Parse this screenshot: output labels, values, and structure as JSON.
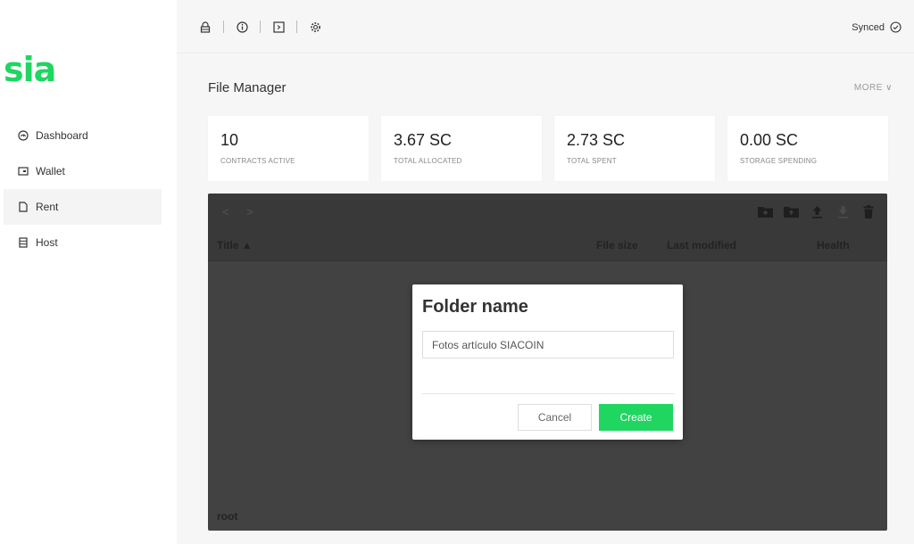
{
  "app": {
    "logo_text": "sia",
    "accent_color": "#1ed660"
  },
  "sidebar": {
    "items": [
      {
        "label": "Dashboard",
        "icon": "gauge-icon",
        "active": false
      },
      {
        "label": "Wallet",
        "icon": "wallet-icon",
        "active": false
      },
      {
        "label": "Rent",
        "icon": "file-icon",
        "active": true
      },
      {
        "label": "Host",
        "icon": "server-icon",
        "active": false
      }
    ]
  },
  "topbar": {
    "icons": [
      "lock-icon",
      "info-icon",
      "terminal-icon",
      "gear-icon"
    ],
    "status": "Synced",
    "status_icon": "check-circle-icon"
  },
  "page": {
    "title": "File Manager",
    "more_label": "MORE ∨"
  },
  "cards": [
    {
      "value": "10",
      "label": "CONTRACTS ACTIVE"
    },
    {
      "value": "3.67 SC",
      "label": "TOTAL ALLOCATED"
    },
    {
      "value": "2.73 SC",
      "label": "TOTAL SPENT"
    },
    {
      "value": "0.00 SC",
      "label": "STORAGE SPENDING"
    }
  ],
  "files": {
    "nav_arrows": "< >",
    "toolbar_icons": [
      "new-folder-icon",
      "upload-folder-icon",
      "upload-icon",
      "download-icon",
      "trash-icon"
    ],
    "columns": {
      "title": "Title ▲",
      "size": "File size",
      "modified": "Last modified",
      "health": "Health"
    },
    "footer_path": "root"
  },
  "modal": {
    "title": "Folder name",
    "input_value": "Fotos artículo SIACOIN",
    "cancel_label": "Cancel",
    "create_label": "Create"
  }
}
